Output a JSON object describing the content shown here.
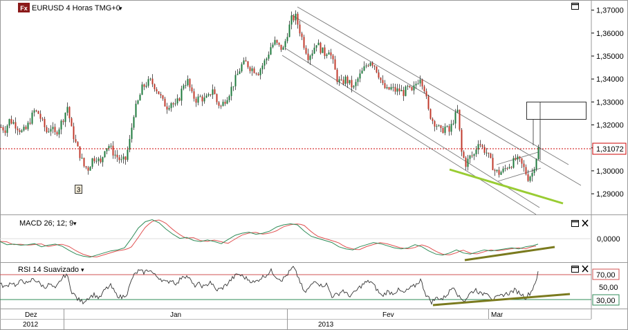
{
  "header": {
    "logo_text": "Fx",
    "instrument_label": "EURUSD 4 Horas TMG+0",
    "dropdown_glyph": "▾",
    "current_price": "1,31072",
    "wave_label": "3"
  },
  "macd_panel": {
    "title": "MACD 26; 12; 9",
    "dropdown_glyph": "▾",
    "axis_label": "0,0000"
  },
  "rsi_panel": {
    "title": "RSI 14 Suavizado",
    "dropdown_glyph": "▾",
    "axis_labels": [
      "70,00",
      "50,00",
      "30,00"
    ]
  },
  "time_axis": {
    "month_labels": [
      "Dez",
      "Jan",
      "Fev",
      "Mar"
    ],
    "year_labels": [
      "2012",
      "2013"
    ]
  },
  "colors": {
    "bull_candle": "#1e7a3c",
    "bear_candle": "#c0392b",
    "price_line": "#cc0000",
    "trend_green": "#99cc33",
    "divergence": "#7a7a1e",
    "macd_line": "#2e8b57",
    "signal_line": "#e05050",
    "rsi_line": "#333333",
    "rsi_overbought": "#d05050",
    "rsi_oversold": "#2e8b57",
    "channel": "#555555"
  },
  "chart_data": {
    "type": "candlestick",
    "ylabels": [
      "1,37000",
      "1,36000",
      "1,35000",
      "1,34000",
      "1,33000",
      "1,32000",
      "1,31000",
      "1,30000",
      "1,29000"
    ],
    "ylim": [
      1.284,
      1.372
    ],
    "current_price": 1.31072,
    "price_path": [
      [
        0,
        1.319
      ],
      [
        6,
        1.318
      ],
      [
        12,
        1.322
      ],
      [
        18,
        1.321
      ],
      [
        24,
        1.319
      ],
      [
        30,
        1.317
      ],
      [
        36,
        1.318
      ],
      [
        42,
        1.322
      ],
      [
        48,
        1.326
      ],
      [
        54,
        1.325
      ],
      [
        60,
        1.321
      ],
      [
        66,
        1.317
      ],
      [
        72,
        1.319
      ],
      [
        78,
        1.316
      ],
      [
        84,
        1.319
      ],
      [
        90,
        1.323
      ],
      [
        96,
        1.328
      ],
      [
        102,
        1.318
      ],
      [
        108,
        1.312
      ],
      [
        114,
        1.307
      ],
      [
        120,
        1.302
      ],
      [
        126,
        1.301
      ],
      [
        132,
        1.305
      ],
      [
        138,
        1.306
      ],
      [
        144,
        1.303
      ],
      [
        150,
        1.31
      ],
      [
        156,
        1.311
      ],
      [
        162,
        1.308
      ],
      [
        168,
        1.306
      ],
      [
        174,
        1.304
      ],
      [
        180,
        1.305
      ],
      [
        186,
        1.313
      ],
      [
        192,
        1.325
      ],
      [
        198,
        1.33
      ],
      [
        204,
        1.336
      ],
      [
        210,
        1.338
      ],
      [
        216,
        1.339
      ],
      [
        222,
        1.337
      ],
      [
        228,
        1.334
      ],
      [
        234,
        1.33
      ],
      [
        240,
        1.328
      ],
      [
        246,
        1.33
      ],
      [
        252,
        1.328
      ],
      [
        258,
        1.332
      ],
      [
        264,
        1.338
      ],
      [
        270,
        1.339
      ],
      [
        276,
        1.333
      ],
      [
        282,
        1.331
      ],
      [
        288,
        1.332
      ],
      [
        294,
        1.331
      ],
      [
        300,
        1.332
      ],
      [
        306,
        1.336
      ],
      [
        312,
        1.33
      ],
      [
        318,
        1.328
      ],
      [
        324,
        1.331
      ],
      [
        330,
        1.334
      ],
      [
        336,
        1.338
      ],
      [
        342,
        1.342
      ],
      [
        348,
        1.346
      ],
      [
        354,
        1.347
      ],
      [
        360,
        1.345
      ],
      [
        366,
        1.344
      ],
      [
        372,
        1.343
      ],
      [
        378,
        1.346
      ],
      [
        384,
        1.349
      ],
      [
        390,
        1.354
      ],
      [
        396,
        1.356
      ],
      [
        402,
        1.354
      ],
      [
        408,
        1.353
      ],
      [
        414,
        1.36
      ],
      [
        420,
        1.366
      ],
      [
        426,
        1.367
      ],
      [
        432,
        1.361
      ],
      [
        438,
        1.355
      ],
      [
        444,
        1.35
      ],
      [
        450,
        1.352
      ],
      [
        456,
        1.356
      ],
      [
        462,
        1.353
      ],
      [
        468,
        1.351
      ],
      [
        474,
        1.353
      ],
      [
        480,
        1.347
      ],
      [
        486,
        1.34
      ],
      [
        492,
        1.338
      ],
      [
        498,
        1.34
      ],
      [
        504,
        1.338
      ],
      [
        510,
        1.336
      ],
      [
        516,
        1.34
      ],
      [
        522,
        1.343
      ],
      [
        528,
        1.346
      ],
      [
        534,
        1.348
      ],
      [
        540,
        1.346
      ],
      [
        546,
        1.342
      ],
      [
        552,
        1.337
      ],
      [
        558,
        1.335
      ],
      [
        564,
        1.336
      ],
      [
        570,
        1.335
      ],
      [
        576,
        1.335
      ],
      [
        582,
        1.334
      ],
      [
        588,
        1.336
      ],
      [
        594,
        1.334
      ],
      [
        600,
        1.338
      ],
      [
        606,
        1.341
      ],
      [
        612,
        1.336
      ],
      [
        618,
        1.326
      ],
      [
        624,
        1.322
      ],
      [
        630,
        1.32
      ],
      [
        636,
        1.317
      ],
      [
        642,
        1.319
      ],
      [
        648,
        1.317
      ],
      [
        654,
        1.322
      ],
      [
        660,
        1.326
      ],
      [
        666,
        1.308
      ],
      [
        672,
        1.303
      ],
      [
        678,
        1.306
      ],
      [
        684,
        1.307
      ],
      [
        690,
        1.313
      ],
      [
        696,
        1.31
      ],
      [
        702,
        1.308
      ],
      [
        708,
        1.304
      ],
      [
        714,
        1.3
      ],
      [
        720,
        1.299
      ],
      [
        726,
        1.3
      ],
      [
        732,
        1.302
      ],
      [
        738,
        1.303
      ],
      [
        744,
        1.305
      ],
      [
        750,
        1.304
      ],
      [
        756,
        1.301
      ],
      [
        762,
        1.297
      ],
      [
        768,
        1.299
      ],
      [
        774,
        1.306
      ],
      [
        778,
        1.311
      ]
    ],
    "macd_path": [
      [
        0,
        0.0002
      ],
      [
        10,
        -0.0004
      ],
      [
        20,
        -0.0003
      ],
      [
        30,
        -0.0005
      ],
      [
        40,
        -0.0004
      ],
      [
        50,
        -0.0002
      ],
      [
        60,
        -0.0008
      ],
      [
        70,
        -0.0005
      ],
      [
        80,
        -0.0003
      ],
      [
        90,
        -0.0007
      ],
      [
        100,
        -0.0015
      ],
      [
        110,
        -0.0022
      ],
      [
        120,
        -0.0026
      ],
      [
        130,
        -0.0028
      ],
      [
        140,
        -0.0024
      ],
      [
        150,
        -0.002
      ],
      [
        160,
        -0.0016
      ],
      [
        170,
        -0.0014
      ],
      [
        180,
        -0.001
      ],
      [
        190,
        0.0008
      ],
      [
        200,
        0.0028
      ],
      [
        210,
        0.004
      ],
      [
        220,
        0.0044
      ],
      [
        230,
        0.0038
      ],
      [
        240,
        0.0026
      ],
      [
        250,
        0.0016
      ],
      [
        260,
        0.0008
      ],
      [
        270,
        0.001
      ],
      [
        280,
        0.0004
      ],
      [
        290,
        0.0002
      ],
      [
        300,
        0.0005
      ],
      [
        310,
        0.0002
      ],
      [
        320,
        -0.0002
      ],
      [
        330,
        0.0006
      ],
      [
        340,
        0.0014
      ],
      [
        350,
        0.0018
      ],
      [
        360,
        0.002
      ],
      [
        370,
        0.0016
      ],
      [
        380,
        0.0018
      ],
      [
        390,
        0.0022
      ],
      [
        400,
        0.003
      ],
      [
        410,
        0.0034
      ],
      [
        420,
        0.0036
      ],
      [
        430,
        0.0034
      ],
      [
        440,
        0.0022
      ],
      [
        450,
        0.0012
      ],
      [
        460,
        0.0008
      ],
      [
        470,
        0.0004
      ],
      [
        480,
        0.0
      ],
      [
        490,
        -0.0008
      ],
      [
        500,
        -0.0012
      ],
      [
        510,
        -0.0014
      ],
      [
        520,
        -0.0008
      ],
      [
        530,
        -0.0004
      ],
      [
        540,
        0.0
      ],
      [
        550,
        -0.0002
      ],
      [
        560,
        -0.0006
      ],
      [
        570,
        -0.001
      ],
      [
        580,
        -0.0012
      ],
      [
        590,
        -0.001
      ],
      [
        600,
        -0.0004
      ],
      [
        610,
        -0.0008
      ],
      [
        620,
        -0.0016
      ],
      [
        630,
        -0.0022
      ],
      [
        640,
        -0.0024
      ],
      [
        650,
        -0.002
      ],
      [
        660,
        -0.0014
      ],
      [
        670,
        -0.002
      ],
      [
        680,
        -0.0022
      ],
      [
        690,
        -0.0018
      ],
      [
        700,
        -0.0014
      ],
      [
        710,
        -0.0016
      ],
      [
        720,
        -0.0014
      ],
      [
        730,
        -0.0012
      ],
      [
        740,
        -0.001
      ],
      [
        750,
        -0.0012
      ],
      [
        760,
        -0.0008
      ],
      [
        770,
        -0.0006
      ],
      [
        778,
        -0.0003
      ]
    ],
    "macd_ylim": [
      -0.0035,
      0.005
    ],
    "rsi_path": [
      [
        0,
        52
      ],
      [
        8,
        48
      ],
      [
        16,
        55
      ],
      [
        24,
        50
      ],
      [
        32,
        58
      ],
      [
        40,
        52
      ],
      [
        48,
        60
      ],
      [
        56,
        54
      ],
      [
        64,
        48
      ],
      [
        72,
        52
      ],
      [
        80,
        45
      ],
      [
        88,
        58
      ],
      [
        96,
        66
      ],
      [
        104,
        42
      ],
      [
        112,
        32
      ],
      [
        120,
        28
      ],
      [
        128,
        34
      ],
      [
        136,
        38
      ],
      [
        144,
        33
      ],
      [
        152,
        45
      ],
      [
        160,
        50
      ],
      [
        168,
        38
      ],
      [
        176,
        34
      ],
      [
        184,
        40
      ],
      [
        192,
        62
      ],
      [
        200,
        70
      ],
      [
        208,
        68
      ],
      [
        216,
        72
      ],
      [
        224,
        64
      ],
      [
        232,
        60
      ],
      [
        240,
        54
      ],
      [
        248,
        58
      ],
      [
        256,
        52
      ],
      [
        264,
        64
      ],
      [
        272,
        62
      ],
      [
        280,
        50
      ],
      [
        288,
        52
      ],
      [
        296,
        48
      ],
      [
        304,
        56
      ],
      [
        312,
        44
      ],
      [
        320,
        46
      ],
      [
        328,
        52
      ],
      [
        336,
        60
      ],
      [
        344,
        66
      ],
      [
        352,
        62
      ],
      [
        360,
        58
      ],
      [
        368,
        54
      ],
      [
        376,
        60
      ],
      [
        384,
        64
      ],
      [
        392,
        70
      ],
      [
        400,
        62
      ],
      [
        408,
        58
      ],
      [
        416,
        66
      ],
      [
        424,
        75
      ],
      [
        432,
        60
      ],
      [
        440,
        40
      ],
      [
        448,
        48
      ],
      [
        456,
        58
      ],
      [
        464,
        50
      ],
      [
        472,
        52
      ],
      [
        480,
        36
      ],
      [
        488,
        38
      ],
      [
        496,
        44
      ],
      [
        504,
        36
      ],
      [
        512,
        40
      ],
      [
        520,
        48
      ],
      [
        528,
        54
      ],
      [
        536,
        56
      ],
      [
        544,
        46
      ],
      [
        552,
        36
      ],
      [
        560,
        42
      ],
      [
        568,
        40
      ],
      [
        576,
        44
      ],
      [
        584,
        40
      ],
      [
        592,
        46
      ],
      [
        600,
        50
      ],
      [
        608,
        58
      ],
      [
        616,
        38
      ],
      [
        624,
        28
      ],
      [
        632,
        34
      ],
      [
        640,
        32
      ],
      [
        648,
        40
      ],
      [
        656,
        50
      ],
      [
        664,
        34
      ],
      [
        672,
        30
      ],
      [
        680,
        40
      ],
      [
        688,
        45
      ],
      [
        696,
        38
      ],
      [
        704,
        42
      ],
      [
        712,
        32
      ],
      [
        720,
        34
      ],
      [
        728,
        38
      ],
      [
        736,
        40
      ],
      [
        744,
        44
      ],
      [
        752,
        40
      ],
      [
        760,
        34
      ],
      [
        768,
        42
      ],
      [
        774,
        55
      ],
      [
        778,
        67
      ]
    ],
    "rsi_ylim": [
      20,
      80
    ],
    "rsi_levels": [
      70,
      50,
      30
    ]
  }
}
